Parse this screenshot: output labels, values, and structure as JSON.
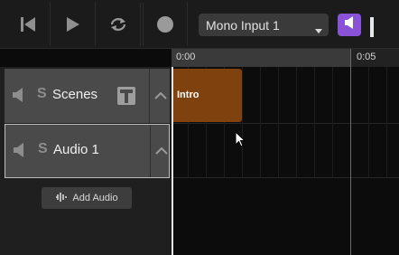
{
  "toolbar": {
    "buttons": [
      {
        "name": "skip-back-icon"
      },
      {
        "name": "play-icon"
      },
      {
        "name": "loop-icon"
      },
      {
        "name": "record-icon"
      }
    ],
    "input_device": "Mono Input 1",
    "monitor_icon": "speaker-icon",
    "input_level": 0.9
  },
  "timeline": {
    "ticks": [
      "0:00",
      "0:05"
    ]
  },
  "tracks": [
    {
      "name": "Scenes",
      "solo": "S",
      "has_scene_button": true,
      "selected": false
    },
    {
      "name": "Audio 1",
      "solo": "S",
      "has_scene_button": false,
      "selected": true
    }
  ],
  "add_audio_label": "Add Audio",
  "clips": [
    {
      "label": "Intro",
      "track": "Scenes",
      "color": "#7f420e"
    }
  ],
  "colors": {
    "accent": "#8a52d6",
    "clip": "#7f420e"
  }
}
